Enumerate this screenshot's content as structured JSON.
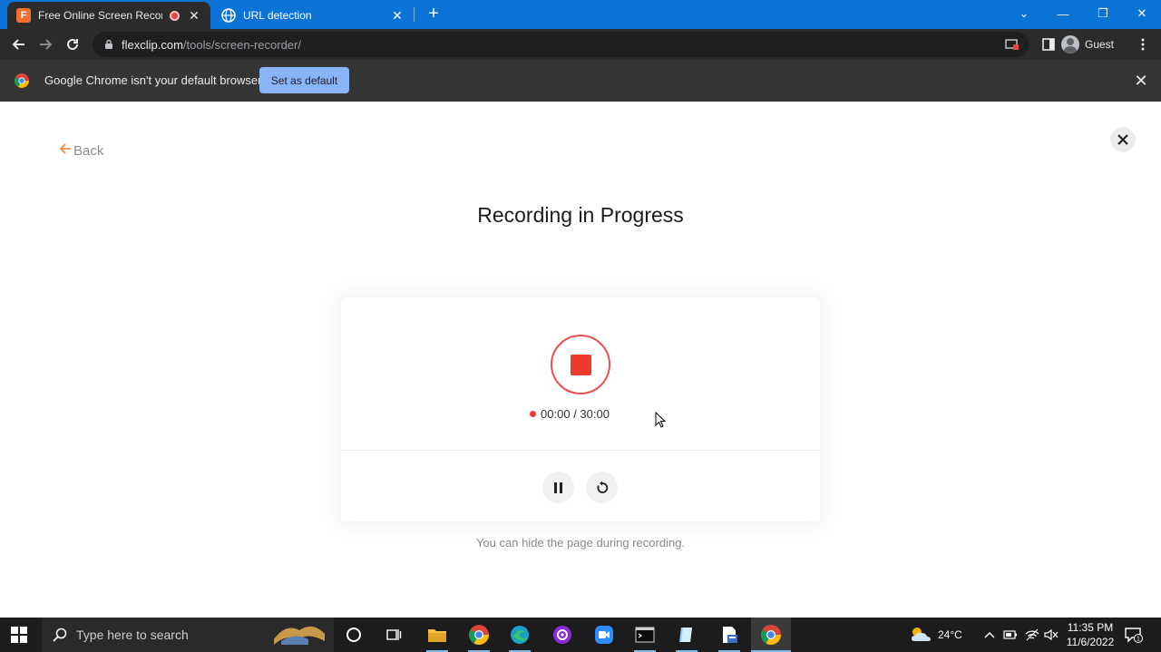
{
  "browser": {
    "tabs": [
      {
        "title": "Free Online Screen Recorder",
        "active": true
      },
      {
        "title": "URL detection",
        "active": false
      }
    ],
    "url_host": "flexclip.com",
    "url_path": "/tools/screen-recorder/",
    "profile_label": "Guest"
  },
  "infobar": {
    "message": "Google Chrome isn't your default browser",
    "button_label": "Set as default"
  },
  "page": {
    "back_label": "Back",
    "title": "Recording in Progress",
    "timer_elapsed": "00:00",
    "timer_total": "30:00",
    "timer_text": "00:00 / 30:00",
    "hint": "You can hide the page during recording.",
    "accent_color": "#ee3b30",
    "back_arrow_color": "#f08a3e"
  },
  "taskbar": {
    "search_placeholder": "Type here to search",
    "weather": "24°C",
    "time": "11:35 PM",
    "date": "11/6/2022",
    "notification_count": "1"
  }
}
